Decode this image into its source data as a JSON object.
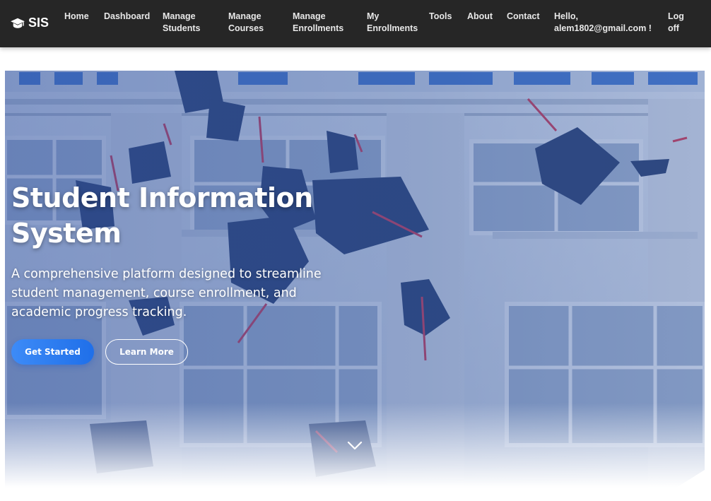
{
  "navbar": {
    "brand": "SIS",
    "links": [
      "Home",
      "Dashboard",
      "Manage\nStudents",
      "Manage\nCourses",
      "Manage\nEnrollments",
      "My\nEnrollments",
      "Tools",
      "About",
      "Contact"
    ],
    "greeting": "Hello,\nalem1802@gmail.com !",
    "logoff": "Log\noff"
  },
  "hero": {
    "title": "Student Information System",
    "subtitle": "A comprehensive platform designed to streamline student management, course enrollment, and academic progress tracking.",
    "primary_button": "Get Started",
    "secondary_button": "Learn More"
  },
  "colors": {
    "navbar_bg": "#262626",
    "accent": "#2f7df2",
    "hero_overlay": "#3d5fa8"
  },
  "icons": {
    "brand": "graduation-cap-icon",
    "scroll": "chevron-down-icon"
  }
}
